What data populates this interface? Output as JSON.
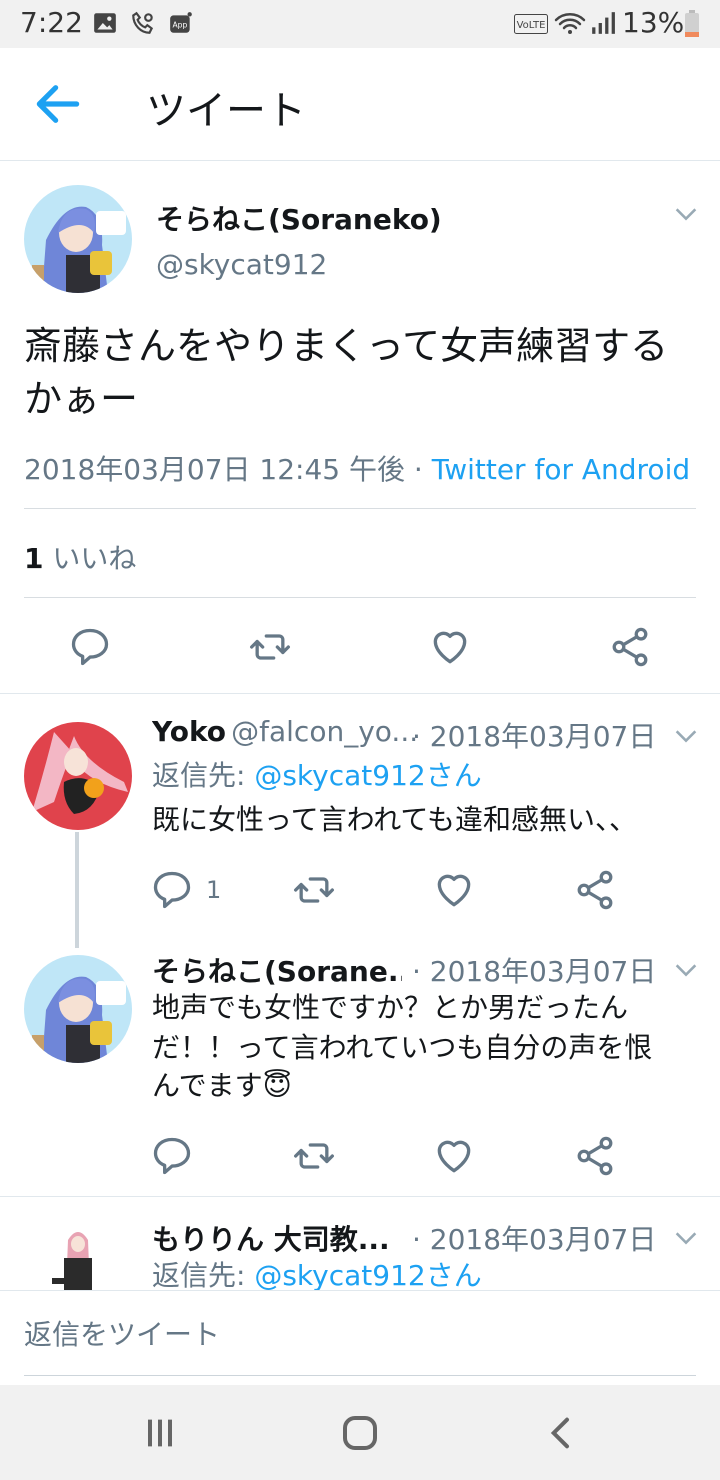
{
  "status_bar": {
    "time": "7:22",
    "battery": "13%",
    "volte": "VoLTE"
  },
  "header": {
    "title": "ツイート"
  },
  "main_tweet": {
    "author_name": "そらねこ(Soraneko)",
    "author_handle": "@skycat912",
    "text": "斎藤さんをやりまくって女声練習するかぁー",
    "timestamp": "2018年03月07日 12:45 午後",
    "separator": " · ",
    "source": "Twitter for Android",
    "likes_count": "1",
    "likes_label": "いいね"
  },
  "replies": [
    {
      "name": "Yoko",
      "handle": "@falcon_yo...",
      "date": "· 2018年03月07日",
      "reply_to_prefix": "返信先: ",
      "reply_to_handle": "@skycat912さん",
      "text": "既に女性って言われても違和感無い、、",
      "reply_count": "1"
    },
    {
      "name": "そらねこ(Sorane...",
      "handle": "",
      "date": "· 2018年03月07日",
      "text_line1": "地声でも女性ですか？とか男だったん",
      "text_line2": "だ！！って言われていつも自分の声を恨",
      "text_line3": "んでます😇"
    },
    {
      "name": "もりりん 大司教...",
      "date": "· 2018年03月07日",
      "reply_to_prefix": "返信先: ",
      "reply_to_handle": "@skycat912さん"
    }
  ],
  "composer": {
    "placeholder": "返信をツイート"
  },
  "colors": {
    "accent": "#1da1f2",
    "secondary_text": "#657786",
    "divider": "#e1e8ed"
  }
}
